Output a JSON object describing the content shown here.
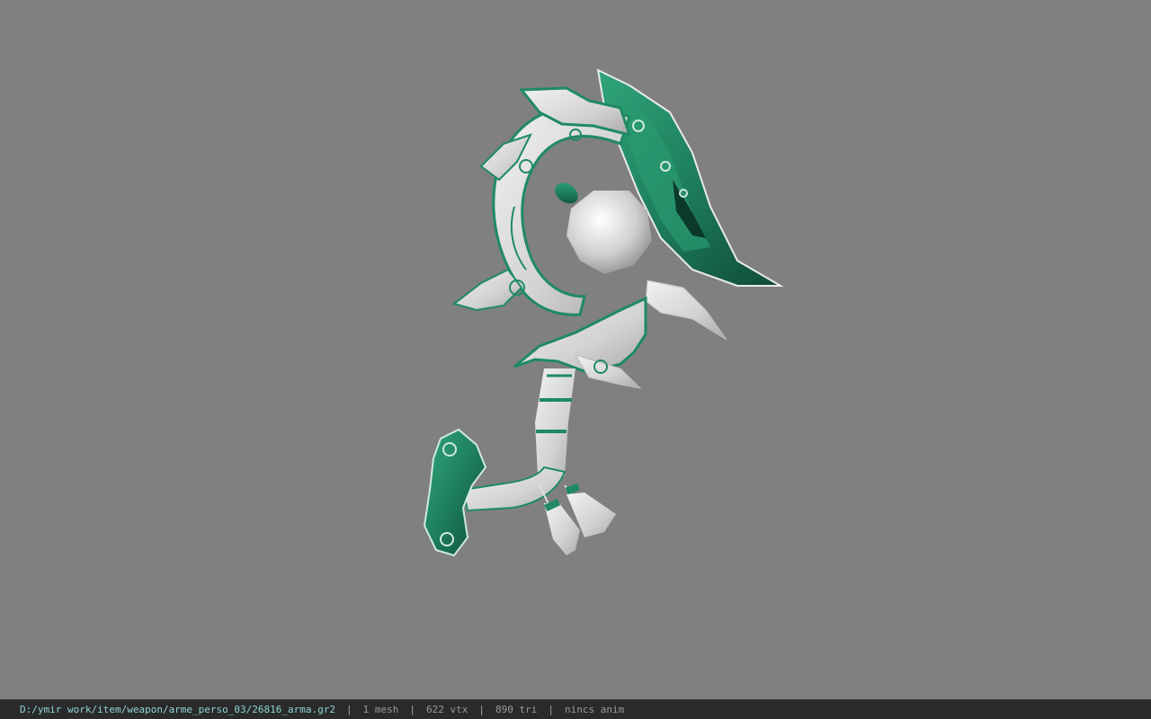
{
  "viewer": {
    "background_color": "#808080",
    "model": {
      "icon": "weapon-model",
      "primary_color": "#1f8a63",
      "secondary_color": "#d9d9d9"
    }
  },
  "status_bar": {
    "file_path": "D:/ymir work/item/weapon/arme_perso_03/26816_arma.gr2",
    "separator": "|",
    "mesh_count": "1 mesh",
    "vertex_count": "622 vtx",
    "triangle_count": "890 tri",
    "animation": "nincs anim"
  }
}
